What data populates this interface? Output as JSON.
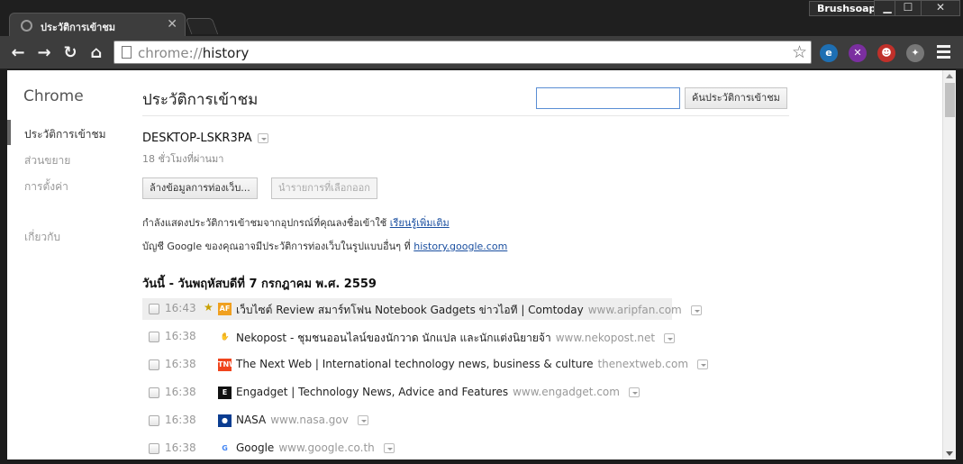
{
  "window": {
    "tab_title": "ประวัติการเข้าชม",
    "tab_close": "✕",
    "profile_name": "Brushsoap",
    "minimize": "▁",
    "maximize": "☐",
    "close": "✕"
  },
  "toolbar": {
    "back": "←",
    "forward": "→",
    "reload": "↻",
    "home": "⌂",
    "url_scheme": "chrome://",
    "url_path": "history",
    "star": "☆",
    "extensions": [
      {
        "icon": "e-extension-icon",
        "glyph": "e",
        "color": "#1e6fb3"
      },
      {
        "icon": "x-extension-icon",
        "glyph": "✕",
        "color": "#7b2fa0"
      },
      {
        "icon": "red-extension-icon",
        "glyph": "☻",
        "color": "#c0302a"
      },
      {
        "icon": "puzzle-extension-icon",
        "glyph": "✦",
        "color": "#777777"
      }
    ]
  },
  "sidebar": {
    "brand": "Chrome",
    "items": [
      {
        "label": "ประวัติการเข้าชม",
        "active": true
      },
      {
        "label": "ส่วนขยาย",
        "active": false
      },
      {
        "label": "การตั้งค่า",
        "active": false
      },
      {
        "label": "เกี่ยวกับ",
        "active": false
      }
    ]
  },
  "main": {
    "title": "ประวัติการเข้าชม",
    "search_placeholder": "",
    "search_button": "ค้นประวัติการเข้าชม",
    "device_name": "DESKTOP-LSKR3PA",
    "device_time": "18 ชั่วโมงที่ผ่านมา",
    "clear_button": "ล้างข้อมูลการท่องเว็บ...",
    "remove_button": "นำรายการที่เลือกออก",
    "info1_text": "กำลังแสดงประวัติการเข้าชมจากอุปกรณ์ที่คุณลงชื่อเข้าใช้",
    "info1_link": "เรียนรู้เพิ่มเติม",
    "info2_text": "บัญชี Google ของคุณอาจมีประวัติการท่องเว็บในรูปแบบอื่นๆ ที่",
    "info2_link": "history.google.com",
    "day_header": "วันนี้ - วันพฤหัสบดีที่ 7 กรกฎาคม พ.ศ. 2559",
    "entries": [
      {
        "time": "16:43",
        "bookmarked": true,
        "fav": "AF",
        "fav_color": "#f0a020",
        "title": "เว็บไซต์ Review สมาร์ทโฟน Notebook Gadgets ข่าวไอที | Comtoday",
        "domain": "www.aripfan.com"
      },
      {
        "time": "16:38",
        "bookmarked": false,
        "fav": "✋",
        "fav_color": "#ffffff",
        "title": "Nekopost - ชุมชนออนไลน์ของนักวาด นักแปล และนักแต่งนิยายจ้า",
        "domain": "www.nekopost.net"
      },
      {
        "time": "16:38",
        "bookmarked": false,
        "fav": "TNW",
        "fav_color": "#f0441d",
        "title": "The Next Web | International technology news, business & culture",
        "domain": "thenextweb.com"
      },
      {
        "time": "16:38",
        "bookmarked": false,
        "fav": "E",
        "fav_color": "#111111",
        "title": "Engadget | Technology News, Advice and Features",
        "domain": "www.engadget.com"
      },
      {
        "time": "16:38",
        "bookmarked": false,
        "fav": "●",
        "fav_color": "#0b3d91",
        "title": "NASA",
        "domain": "www.nasa.gov"
      },
      {
        "time": "16:38",
        "bookmarked": false,
        "fav": "G",
        "fav_color": "#ffffff",
        "title": "Google",
        "domain": "www.google.co.th"
      }
    ]
  }
}
